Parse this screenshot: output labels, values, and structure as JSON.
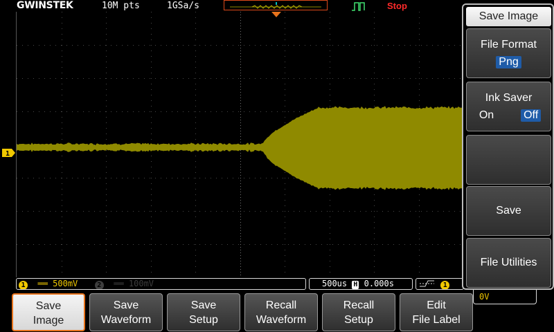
{
  "brand": "GWINSTEK",
  "topbar": {
    "record_length": "10M pts",
    "sample_rate": "1GSa/s",
    "trigger_state": "Stop"
  },
  "channels": {
    "ch1": {
      "number": "1",
      "scale": "500mV"
    },
    "ch2": {
      "number": "2",
      "scale": "100mV"
    }
  },
  "timebase": {
    "scale": "500us",
    "position": "0.000s",
    "h_label": "H"
  },
  "trigger": {
    "source": "1",
    "level": "0V"
  },
  "side_menu": {
    "title": "Save Image",
    "file_format": {
      "label": "File Format",
      "value": "Png"
    },
    "ink_saver": {
      "label": "Ink Saver",
      "on": "On",
      "off": "Off",
      "selected": "Off"
    },
    "empty": "",
    "save": "Save",
    "file_utilities": "File Utilities"
  },
  "softkeys": [
    {
      "label": "Save\nImage",
      "active": true
    },
    {
      "label": "Save\nWaveform",
      "active": false
    },
    {
      "label": "Save\nSetup",
      "active": false
    },
    {
      "label": "Recall\nWaveform",
      "active": false
    },
    {
      "label": "Recall\nSetup",
      "active": false
    },
    {
      "label": "Edit\nFile Label",
      "active": false
    }
  ],
  "colors": {
    "ch1": "#f0c800",
    "trace": "#8f8a00",
    "stop": "#ff2a2a",
    "accent": "#e8731c",
    "selection": "#1f5ca8",
    "grid": "#4a4a4a"
  }
}
